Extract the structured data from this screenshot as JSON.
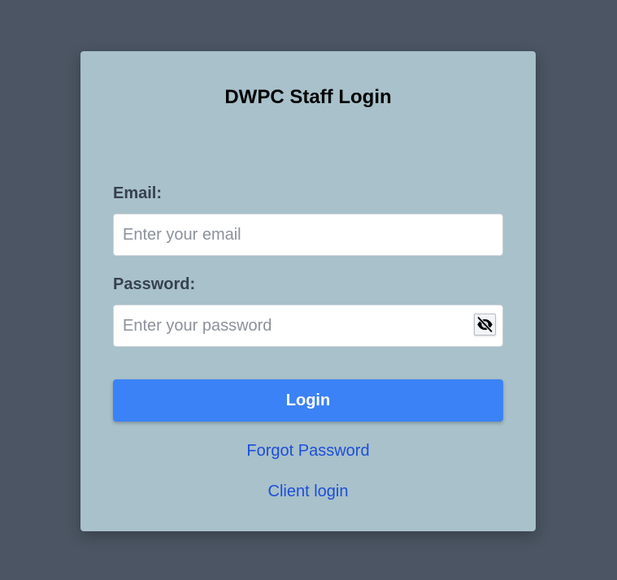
{
  "form": {
    "title": "DWPC Staff Login",
    "email_label": "Email:",
    "email_placeholder": "Enter your email",
    "email_value": "",
    "password_label": "Password:",
    "password_placeholder": "Enter your password",
    "password_value": "",
    "password_toggle_icon": "eye-slash-icon",
    "login_label": "Login",
    "forgot_password_label": "Forgot Password",
    "client_login_label": "Client login"
  },
  "colors": {
    "page_background": "#4b5563",
    "card_background": "#a8c1ca",
    "primary_button": "#3b82f6",
    "link": "#1d4ed8"
  }
}
